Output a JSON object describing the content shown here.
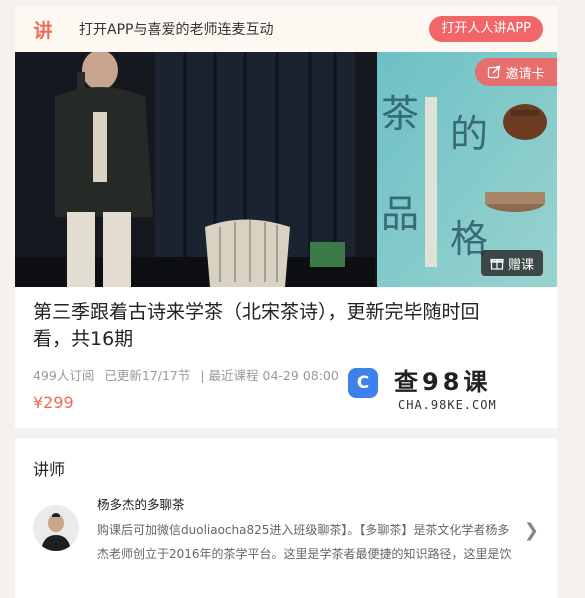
{
  "banner": {
    "logo": "讲",
    "text": "打开APP与喜爱的老师连麦互动",
    "open_label": "打开人人讲APP"
  },
  "hero": {
    "invite_label": "邀请卡",
    "gift_label": "赠课",
    "book_text": "茶的品格"
  },
  "course": {
    "title": "第三季跟着古诗来学茶（北宋茶诗），更新完毕随时回看，共16期",
    "subscribers": "499人订阅",
    "updated": "已更新17/17节",
    "latest": "| 最近课程 04-29 08:00",
    "price": "¥299"
  },
  "watermark": {
    "name": "查98课",
    "domain": "CHA.98KE.COM"
  },
  "teacher": {
    "section_title": "讲师",
    "name": "杨多杰的多聊茶",
    "description": "购课后可加微信duoliaocha825进入班级聊茶】。【多聊茶】是茶文化学者杨多杰老师创立于2016年的茶学平台。这里是学茶者最便捷的知识路径，这里是饮"
  },
  "colors": {
    "accent": "#f2666a",
    "price": "#ee6a5a"
  }
}
